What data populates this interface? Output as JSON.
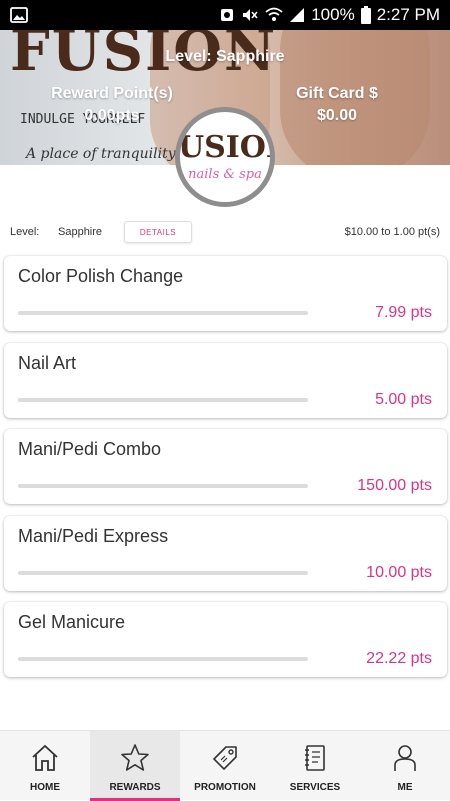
{
  "status_bar": {
    "battery": "100%",
    "time": "2:27 PM"
  },
  "hero": {
    "brand_text": "FUSION",
    "tagline": "INDULGE YOURSELF",
    "subtagline": "A place of tranquility",
    "level_label": "Level: Sapphire",
    "reward_points_label": "Reward Point(s)",
    "reward_points_value": "0.00pts",
    "gift_card_label": "Gift Card $",
    "gift_card_value": "$0.00"
  },
  "logo": {
    "line1": "FUSION",
    "line2": "nails & spa"
  },
  "level_row": {
    "label": "Level:",
    "value": "Sapphire",
    "details_label": "DETAILS",
    "rate": "$10.00 to 1.00 pt(s)"
  },
  "rewards": [
    {
      "name": "Color Polish Change",
      "points": "7.99 pts",
      "progress": 0
    },
    {
      "name": "Nail Art",
      "points": "5.00 pts",
      "progress": 0
    },
    {
      "name": "Mani/Pedi Combo",
      "points": "150.00 pts",
      "progress": 0
    },
    {
      "name": "Mani/Pedi Express",
      "points": "10.00 pts",
      "progress": 0
    },
    {
      "name": "Gel Manicure",
      "points": "22.22 pts",
      "progress": 0
    }
  ],
  "tabs": [
    {
      "label": "HOME",
      "icon": "home-icon",
      "active": false
    },
    {
      "label": "REWARDS",
      "icon": "star-icon",
      "active": true
    },
    {
      "label": "PROMOTION",
      "icon": "tag-icon",
      "active": false
    },
    {
      "label": "SERVICES",
      "icon": "notebook-icon",
      "active": false
    },
    {
      "label": "ME",
      "icon": "person-icon",
      "active": false
    }
  ],
  "colors": {
    "accent": "#e0337f",
    "status_bar": "#000000"
  }
}
